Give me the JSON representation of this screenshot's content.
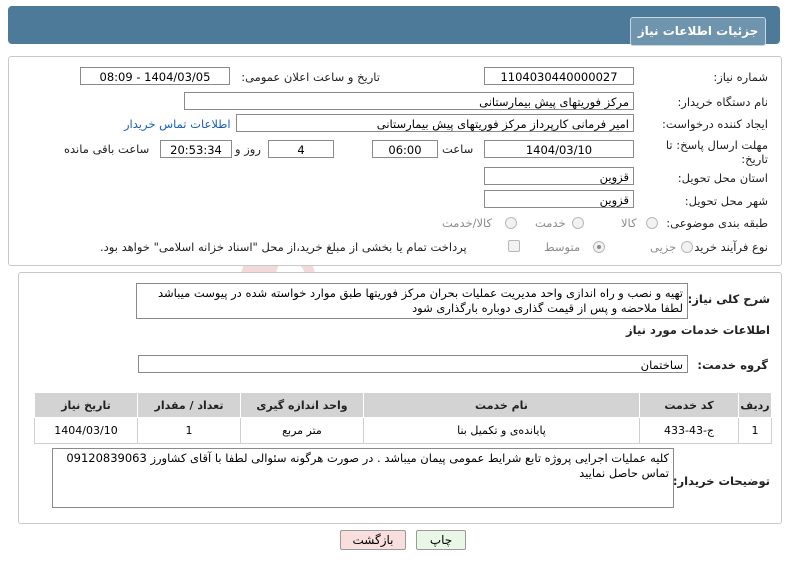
{
  "header": {
    "title": "جزئیات اطلاعات نیاز"
  },
  "fields": {
    "need_number_label": "شماره نیاز:",
    "need_number": "1104030440000027",
    "announce_datetime_label": "تاریخ و ساعت اعلان عمومی:",
    "announce_datetime": "1404/03/05 - 08:09",
    "buyer_org_label": "نام دستگاه خریدار:",
    "buyer_org": "مرکز فوریتهای پیش بیمارستانی",
    "requester_label": "ایجاد کننده درخواست:",
    "requester": "امیر فرمانی کارپرداز مرکز فوریتهای پیش بیمارستانی",
    "buyer_contact_link": "اطلاعات تماس خریدار",
    "deadline_label": "مهلت ارسال پاسخ: تا تاریخ:",
    "deadline_date": "1404/03/10",
    "time_label": "ساعت",
    "deadline_time": "06:00",
    "days_value": "4",
    "days_label": "روز و",
    "remaining_time": "20:53:34",
    "remaining_label": "ساعت باقی مانده",
    "province_label": "استان محل تحویل:",
    "province": "قزوین",
    "city_label": "شهر محل تحویل:",
    "city": "قزوین",
    "category_label": "طبقه بندی موضوعی:",
    "category_options": [
      "کالا",
      "خدمت",
      "کالا/خدمت"
    ],
    "process_label": "نوع فرآیند خرید :",
    "process_options": [
      "جزیی",
      "متوسط"
    ],
    "payment_note": "پرداخت تمام یا بخشی از مبلغ خرید،از محل \"اسناد خزانه اسلامی\" خواهد بود."
  },
  "summary": {
    "label": "شرح کلی نیاز:",
    "text": "تهیه و نصب و راه اندازی واحد مدیریت عملیات بحران مرکز فوریتها طبق موارد خواسته شده در پیوست میباشد لطفا ملاحضه و پس از قیمت گذاری دوباره بارگذاری شود"
  },
  "services": {
    "section_title": "اطلاعات خدمات مورد نیاز",
    "group_label": "گروه خدمت:",
    "group_value": "ساختمان",
    "columns": [
      "ردیف",
      "کد خدمت",
      "نام خدمت",
      "واحد اندازه گیری",
      "تعداد / مقدار",
      "تاریخ نیاز"
    ],
    "rows": [
      [
        "1",
        "ج-43-433",
        "پایانده‌ی و تکمیل بنا",
        "متر مربع",
        "1",
        "1404/03/10"
      ]
    ]
  },
  "buyer_notes": {
    "label": "توضیحات خریدار:",
    "text": "کلیه عملیات اجرایی پروژه تابع شرایط عمومی پیمان میباشد . در صورت هرگونه سئوالی لطفا با آقای کشاورز 09120839063 تماس حاصل نمایید"
  },
  "buttons": {
    "print": "چاپ",
    "back": "بازگشت"
  },
  "colors": {
    "header": "#4d7a99",
    "tab": "#6f94ae",
    "link": "#1a5fb4",
    "back_button": "#f9dede",
    "print_button": "#e9f7e6"
  }
}
